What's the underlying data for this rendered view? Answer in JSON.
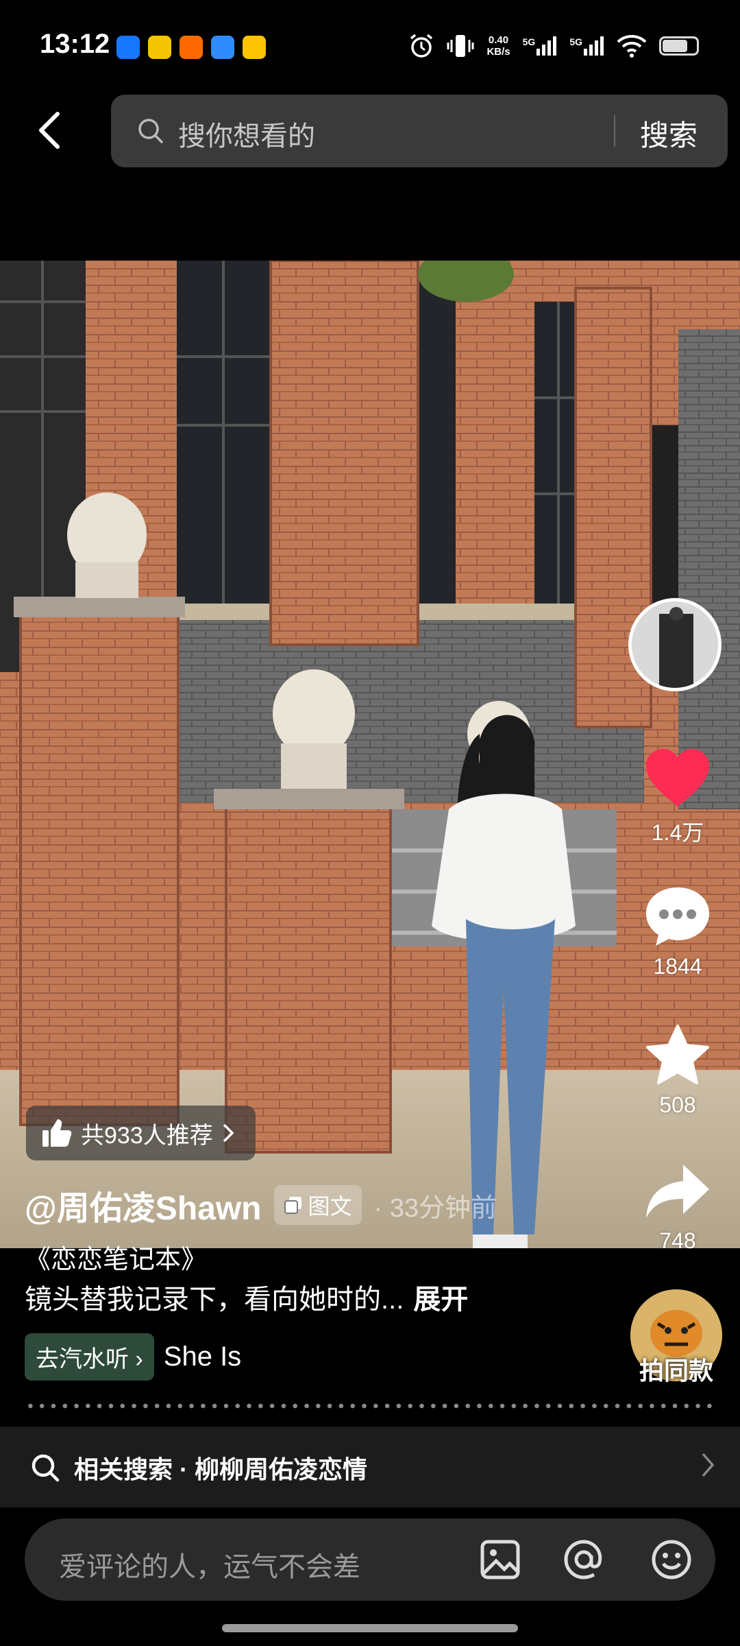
{
  "status": {
    "time": "13:12",
    "apps": [
      {
        "icon": "alipay-icon",
        "label": "支",
        "color": "#1677ff"
      },
      {
        "icon": "app-yellow-icon",
        "label": "闲鱼",
        "color": "#f5c400"
      },
      {
        "icon": "app-orange-icon",
        "label": "淘",
        "color": "#ff6a00"
      },
      {
        "icon": "app-blue-icon",
        "label": "",
        "color": "#2f8cff"
      },
      {
        "icon": "meituan-icon",
        "label": "美团",
        "color": "#ffc300"
      }
    ],
    "net_speed_value": "0.40",
    "net_speed_unit": "KB/s",
    "sig1": "5G",
    "sig2": "5G",
    "battery_level": 0.7
  },
  "search": {
    "placeholder": "搜你想看的",
    "button": "搜索"
  },
  "actions": {
    "likes": "1.4万",
    "comments": "1844",
    "favorites": "508",
    "shares": "748",
    "like_color": "#fe2c55"
  },
  "post": {
    "recommend": "共933人推荐",
    "author": "@周佑凌Shawn",
    "type": "图文",
    "time_ago": "· 33分钟前",
    "title": "《恋恋笔记本》",
    "desc": "镜头替我记录下，看向她时的...",
    "expand": "展开",
    "music_chip": "去汽水听",
    "music_name": "She Is",
    "same_style": "拍同款"
  },
  "related": {
    "label": "相关搜索 · 柳柳周佑凌恋情"
  },
  "comment": {
    "placeholder": "爱评论的人，运气不会差"
  }
}
